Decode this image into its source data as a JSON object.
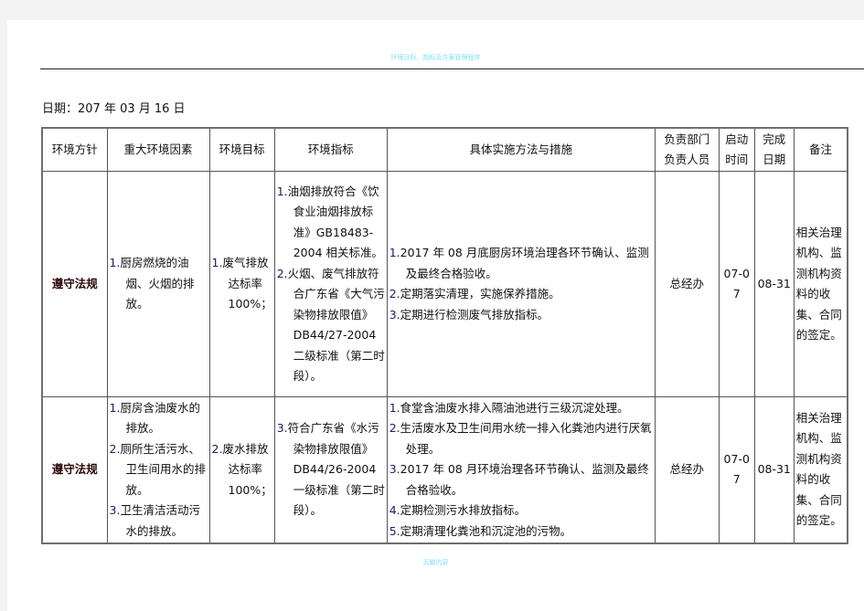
{
  "header": {
    "title": "环境目标、指标及方案管理程序"
  },
  "date_line": "日期：207 年 03 月 16 日",
  "table": {
    "columns": [
      "环境方针",
      "重大环境因素",
      "环境目标",
      "环境指标",
      "具体实施方法与措施",
      "负责部门\n负责人员",
      "启动\n时间",
      "完成\n日期",
      "备注"
    ],
    "column_lines": {
      "dept": [
        "负责部门",
        "负责人员"
      ],
      "start": [
        "启动",
        "时间"
      ],
      "finish": [
        "完成",
        "日期"
      ]
    },
    "rows": [
      {
        "policy": "遵守法规",
        "factors": [
          {
            "num": "1.",
            "text": "厨房燃烧的油烟、火烟的排放。"
          }
        ],
        "targets": [
          {
            "num": "1.",
            "text": "废气排放达标率 100%；"
          }
        ],
        "indicators": [
          {
            "num": "1.",
            "text": "油烟排放符合《饮食业油烟排放标准》GB18483-2004 相关标准。"
          },
          {
            "num": "2.",
            "text": "火烟、废气排放符合广东省《大气污染物排放限值》DB44/27-2004 二级标准（第二时段）。"
          }
        ],
        "measures": [
          {
            "num": "1.",
            "text": "2017 年 08 月底厨房环境治理各环节确认、监测及最终合格验收。"
          },
          {
            "num": "2.",
            "text": "定期落实清理，实施保养措施。"
          },
          {
            "num": "3.",
            "text": "定期进行检测废气排放指标。"
          }
        ],
        "dept": "总经办",
        "start": "07-07",
        "finish": "08-31",
        "remark": "相关治理机构、监测机构资料的收集、合同的签定。"
      },
      {
        "policy": "遵守法规",
        "factors": [
          {
            "num": "1.",
            "text": "厨房含油废水的排放。"
          },
          {
            "num": "2.",
            "text": "厕所生活污水、卫生间用水的排放。"
          },
          {
            "num": "3.",
            "text": "卫生清洁活动污水的排放。"
          }
        ],
        "targets": [
          {
            "num": "2.",
            "text": "废水排放 达标率 100%；"
          }
        ],
        "indicators": [
          {
            "num": "3.",
            "text": "符合广东省《水污染物排放限值》DB44/26-2004 一级标准（第二时段）。"
          }
        ],
        "measures": [
          {
            "num": "1.",
            "text": "食堂含油废水排入隔油池进行三级沉淀处理。"
          },
          {
            "num": "2.",
            "text": "生活废水及卫生间用水统一排入化粪池内进行厌氧处理。"
          },
          {
            "num": "3.",
            "text": "2017 年 08 月环境治理各环节确认、监测及最终合格验收。"
          },
          {
            "num": "4.",
            "text": "定期检测污水排放指标。"
          },
          {
            "num": "5.",
            "text": "定期清理化粪池和沉淀池的污物。"
          }
        ],
        "dept": "总经办",
        "start": "07-07",
        "finish": "08-31",
        "remark": "相关治理机构、监测机构资料的收集、合同的签定。"
      }
    ]
  },
  "footer": {
    "text": "页脚内容"
  }
}
